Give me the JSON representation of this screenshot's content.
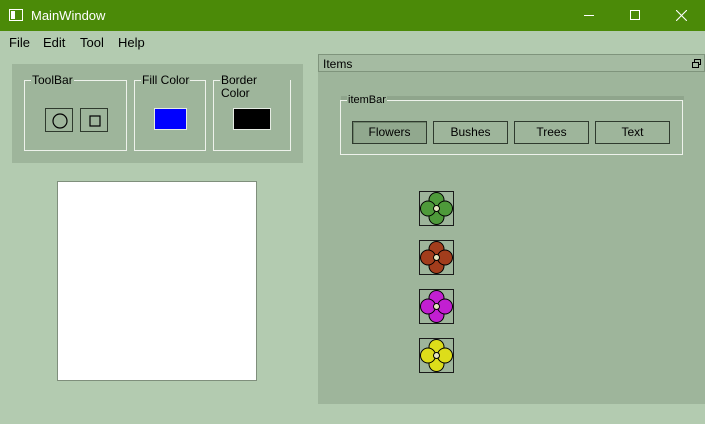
{
  "window": {
    "title": "MainWindow"
  },
  "menu": [
    "File",
    "Edit",
    "Tool",
    "Help"
  ],
  "toolbar": {
    "group_title": "ToolBar",
    "tools": [
      {
        "name": "circle",
        "icon": "circle-icon"
      },
      {
        "name": "rectangle",
        "icon": "square-icon"
      }
    ]
  },
  "fill_color": {
    "title": "Fill Color",
    "color": "#0000ff"
  },
  "border_color": {
    "title": "Border Color",
    "color": "#000000"
  },
  "dock": {
    "title": "Items",
    "itembar": {
      "title": "itemBar",
      "tabs": [
        "Flowers",
        "Bushes",
        "Trees",
        "Text"
      ],
      "active_tab": "Flowers"
    },
    "flowers": [
      {
        "color": "#4e9a3a",
        "icon": "flower-icon"
      },
      {
        "color": "#a23d1c",
        "icon": "flower-icon"
      },
      {
        "color": "#c21fd1",
        "icon": "flower-icon"
      },
      {
        "color": "#dddd1a",
        "icon": "flower-icon"
      }
    ]
  },
  "colors": {
    "titlebar": "#4b8a08",
    "background": "#b3cbb0",
    "panel": "#9eb59b"
  }
}
